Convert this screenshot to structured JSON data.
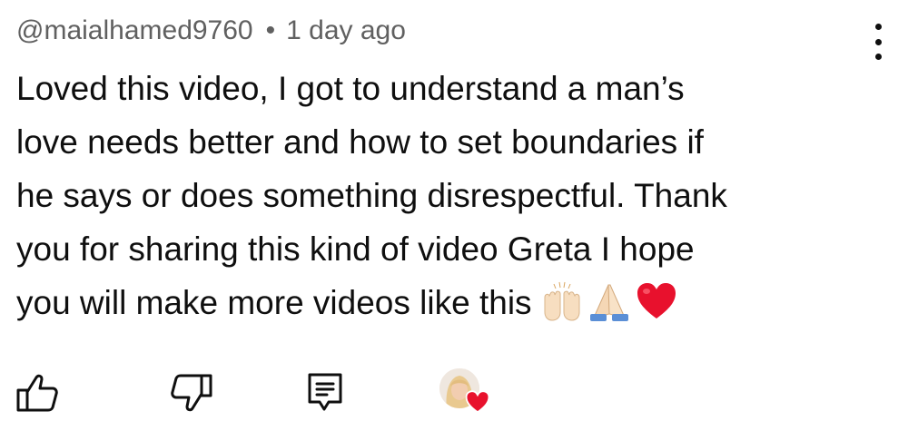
{
  "comment": {
    "author": "@maialhamed9760",
    "separator": "•",
    "timestamp": "1 day ago",
    "lines": [
      "Loved this video, I got to understand a man’s",
      "love needs better and how to set boundaries if",
      "he says or does something disrespectful. Thank",
      "you for sharing this kind of video Greta I hope",
      "you will make more videos like this"
    ],
    "emojis": [
      "raising-hands-emoji",
      "folded-hands-emoji",
      "red-heart-emoji"
    ]
  },
  "actions": {
    "like_icon": "thumbs-up-icon",
    "dislike_icon": "thumbs-down-icon",
    "reply_icon": "reply-comment-icon",
    "creator_heart_icon": "creator-heart-icon"
  },
  "colors": {
    "text": "#0f0f0f",
    "meta": "#606060",
    "heart": "#e8112d"
  }
}
